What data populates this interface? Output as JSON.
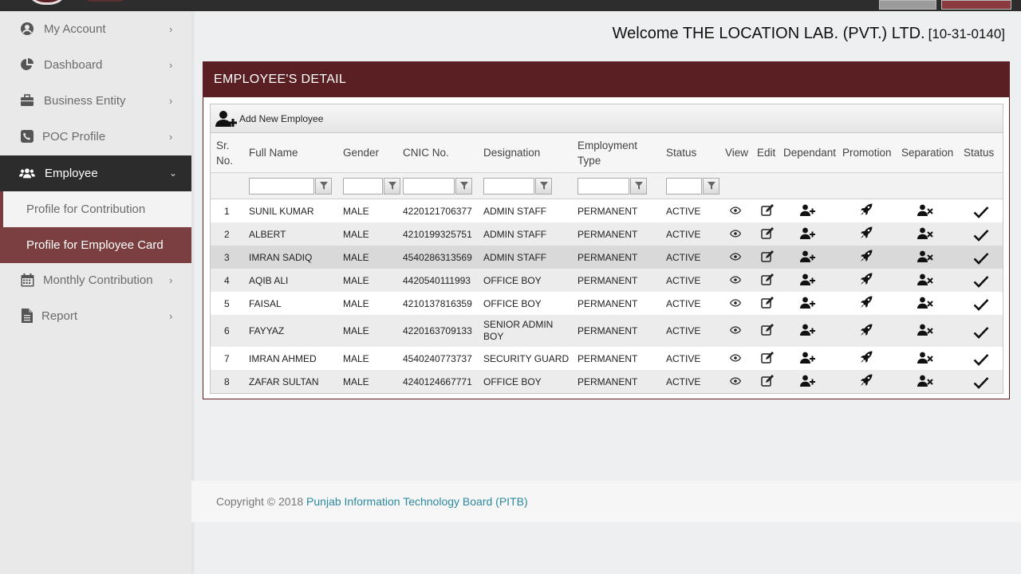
{
  "welcome": {
    "text": "Welcome THE LOCATION LAB. (PVT.) LTD.",
    "code": "[10-31-0140]"
  },
  "sidebar": {
    "items": [
      {
        "label": "My Account",
        "icon": "user-circle-icon"
      },
      {
        "label": "Dashboard",
        "icon": "pie-chart-icon"
      },
      {
        "label": "Business Entity",
        "icon": "briefcase-icon"
      },
      {
        "label": "POC Profile",
        "icon": "phone-icon"
      },
      {
        "label": "Employee",
        "icon": "users-icon"
      },
      {
        "label": "Monthly Contribution",
        "icon": "calendar-icon"
      },
      {
        "label": "Report",
        "icon": "file-icon"
      }
    ],
    "subitems": [
      {
        "label": "Profile for Contribution"
      },
      {
        "label": "Profile for Employee Card"
      }
    ]
  },
  "panel": {
    "title": "EMPLOYEE'S DETAIL",
    "add_label": "Add New Employee"
  },
  "table": {
    "headers": {
      "sr_line1": "Sr.",
      "sr_line2": "No.",
      "name": "Full Name",
      "gender": "Gender",
      "cnic": "CNIC No.",
      "designation": "Designation",
      "emp_type_line1": "Employment",
      "emp_type_line2": "Type",
      "status": "Status",
      "view": "View",
      "edit": "Edit",
      "dependant": "Dependant",
      "promotion": "Promotion",
      "separation": "Separation",
      "status2": "Status"
    },
    "rows": [
      {
        "sr": "1",
        "name": "SUNIL KUMAR",
        "gender": "MALE",
        "cnic": "4220121706377",
        "designation": "ADMIN STAFF",
        "type": "PERMANENT",
        "status": "ACTIVE"
      },
      {
        "sr": "2",
        "name": "ALBERT",
        "gender": "MALE",
        "cnic": "4210199325751",
        "designation": "ADMIN STAFF",
        "type": "PERMANENT",
        "status": "ACTIVE"
      },
      {
        "sr": "3",
        "name": "IMRAN SADIQ",
        "gender": "MALE",
        "cnic": "4540286313569",
        "designation": "ADMIN STAFF",
        "type": "PERMANENT",
        "status": "ACTIVE"
      },
      {
        "sr": "4",
        "name": "AQIB ALI",
        "gender": "MALE",
        "cnic": "4420540111993",
        "designation": "OFFICE BOY",
        "type": "PERMANENT",
        "status": "ACTIVE"
      },
      {
        "sr": "5",
        "name": "FAISAL",
        "gender": "MALE",
        "cnic": "4210137816359",
        "designation": "OFFICE BOY",
        "type": "PERMANENT",
        "status": "ACTIVE"
      },
      {
        "sr": "6",
        "name": "FAYYAZ",
        "gender": "MALE",
        "cnic": "4220163709133",
        "designation_line1": "SENIOR ADMIN",
        "designation_line2": "BOY",
        "type": "PERMANENT",
        "status": "ACTIVE"
      },
      {
        "sr": "7",
        "name": "IMRAN AHMED",
        "gender": "MALE",
        "cnic": "4540240773737",
        "designation": "SECURITY GUARD",
        "type": "PERMANENT",
        "status": "ACTIVE"
      },
      {
        "sr": "8",
        "name": "ZAFAR SULTAN",
        "gender": "MALE",
        "cnic": "4240124667771",
        "designation": "OFFICE BOY",
        "type": "PERMANENT",
        "status": "ACTIVE"
      }
    ]
  },
  "footer": {
    "copyright": "Copyright © 2018",
    "link": "Punjab Information Technology Board (PITB)"
  },
  "colors": {
    "brand": "#5a1f22",
    "active_sub": "#7b3f42",
    "link": "#2c8a9e"
  }
}
